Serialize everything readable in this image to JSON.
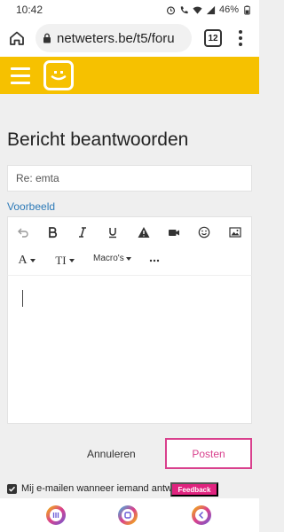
{
  "status_bar": {
    "time": "10:42",
    "battery": "46%"
  },
  "browser": {
    "url": "netweters.be/t5/foru",
    "tab_count": "12"
  },
  "page": {
    "title": "Bericht beantwoorden",
    "subject_value": "Re: emta",
    "preview_link": "Voorbeeld",
    "macros_label": "Macro's",
    "font_label": "A",
    "text_size_label": "TI"
  },
  "actions": {
    "cancel_label": "Annuleren",
    "post_label": "Posten"
  },
  "notify": {
    "label": "Mij e-mailen wanneer iemand antwoordt"
  },
  "feedback": {
    "label": "Feedback"
  },
  "colors": {
    "brand_yellow": "#f6c100",
    "accent_pink": "#d9408d",
    "link_blue": "#2d7ab8"
  }
}
